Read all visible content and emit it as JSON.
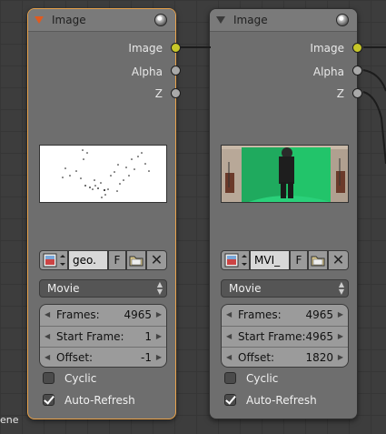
{
  "nodes": [
    {
      "title": "Image",
      "selected": true,
      "outputs": [
        "Image",
        "Alpha",
        "Z"
      ],
      "image_name": "geo.",
      "fake_user_label": "F",
      "source": "Movie",
      "fields": [
        {
          "label": "Frames:",
          "value": "4965"
        },
        {
          "label": "Start Frame:",
          "value": "1"
        },
        {
          "label": "Offset:",
          "value": "-1"
        }
      ],
      "cyclic_label": "Cyclic",
      "cyclic": false,
      "auto_refresh_label": "Auto-Refresh",
      "auto_refresh": true,
      "preview": "white image with scattered black dots"
    },
    {
      "title": "Image",
      "selected": false,
      "outputs": [
        "Image",
        "Alpha",
        "Z"
      ],
      "image_name": "MVI_",
      "fake_user_label": "F",
      "source": "Movie",
      "fields": [
        {
          "label": "Frames:",
          "value": "4965"
        },
        {
          "label": "Start Frame:",
          "value": "4965"
        },
        {
          "label": "Offset:",
          "value": "1820"
        }
      ],
      "cyclic_label": "Cyclic",
      "cyclic": false,
      "auto_refresh_label": "Auto-Refresh",
      "auto_refresh": true,
      "preview": "green screen frame with a person standing"
    }
  ],
  "edge_text": "ene",
  "colors": {
    "background": "#3d3d3d",
    "node_body": "#6e6e6e",
    "selected_outline": "#e8a24a",
    "image_socket": "#c7c729",
    "grey_socket": "#a9a9a9",
    "collapse_arrow": "#e05a1f"
  }
}
